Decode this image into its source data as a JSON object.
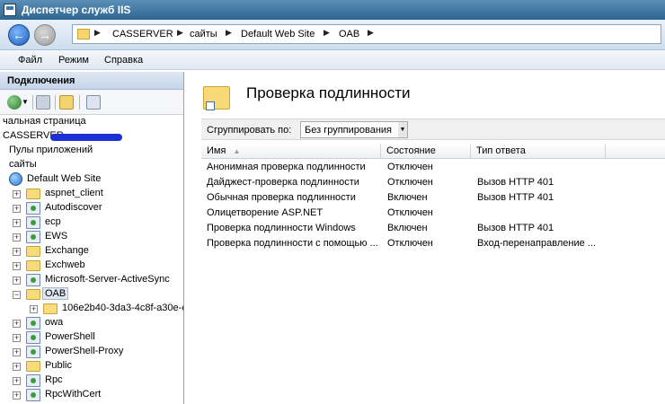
{
  "window": {
    "title": "Диспетчер служб IIS"
  },
  "address": {
    "crumbs": [
      "CASSERVER",
      "сайты",
      "Default Web Site",
      "OAB"
    ]
  },
  "menu": {
    "items": [
      "Файл",
      "Режим",
      "Справка"
    ]
  },
  "connections": {
    "title": "Подключения",
    "tree": [
      {
        "label": "чальная страница"
      },
      {
        "label": "CASSERVER"
      },
      {
        "label": "Пулы приложений"
      },
      {
        "label": "сайты"
      },
      {
        "label": "Default Web Site"
      },
      {
        "label": "aspnet_client"
      },
      {
        "label": "Autodiscover"
      },
      {
        "label": "ecp"
      },
      {
        "label": "EWS"
      },
      {
        "label": "Exchange"
      },
      {
        "label": "Exchweb"
      },
      {
        "label": "Microsoft-Server-ActiveSync"
      },
      {
        "label": "OAB"
      },
      {
        "label": "106e2b40-3da3-4c8f-a30e-c"
      },
      {
        "label": "owa"
      },
      {
        "label": "PowerShell"
      },
      {
        "label": "PowerShell-Proxy"
      },
      {
        "label": "Public"
      },
      {
        "label": "Rpc"
      },
      {
        "label": "RpcWithCert"
      }
    ]
  },
  "main": {
    "title": "Проверка подлинности",
    "group_label": "Сгруппировать по:",
    "group_value": "Без группирования",
    "columns": [
      "Имя",
      "Состояние",
      "Тип ответа"
    ],
    "rows": [
      [
        "Анонимная проверка подлинности",
        "Отключен",
        ""
      ],
      [
        "Дайджест-проверка подлинности",
        "Отключен",
        "Вызов HTTP 401"
      ],
      [
        "Обычная проверка подлинности",
        "Включен",
        "Вызов HTTP 401"
      ],
      [
        "Олицетворение ASP.NET",
        "Отключен",
        ""
      ],
      [
        "Проверка подлинности Windows",
        "Включен",
        "Вызов HTTP 401"
      ],
      [
        "Проверка подлинности с помощью ...",
        "Отключен",
        "Вход-перенаправление ..."
      ]
    ]
  },
  "colors": {
    "accent": "#2e6591",
    "selection": "#dfe6ef",
    "redaction": "#1e2fd6"
  }
}
